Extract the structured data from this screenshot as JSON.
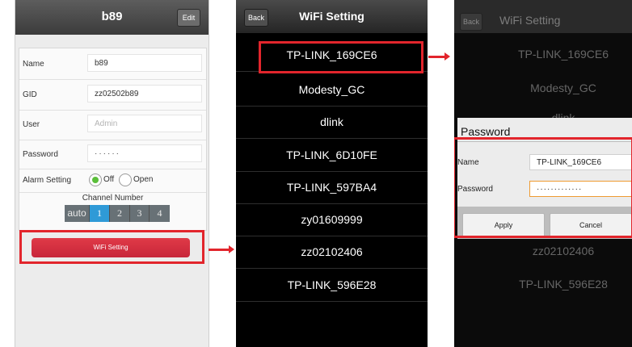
{
  "colors": {
    "highlight": "#e2252c",
    "radio_on": "#5bbf3a",
    "channel_selected": "#2f9ad7",
    "wifi_button": "#d32f3f"
  },
  "screen1": {
    "title": "b89",
    "edit_label": "Edit",
    "fields": [
      {
        "label": "Name",
        "value": "b89"
      },
      {
        "label": "GID",
        "value": "zz02502b89"
      },
      {
        "label": "User",
        "value": "Admin"
      },
      {
        "label": "Password",
        "value": "······"
      }
    ],
    "alarm": {
      "label": "Alarm Setting",
      "off": "Off",
      "open": "Open",
      "selected": "Off"
    },
    "channel": {
      "title": "Channel Number",
      "options": [
        "auto",
        "1",
        "2",
        "3",
        "4"
      ],
      "selected": "1"
    },
    "wifi_button": "WiFi Setting"
  },
  "screen2": {
    "back": "Back",
    "title": "WiFi Setting",
    "networks": [
      "TP-LINK_169CE6",
      "Modesty_GC",
      "dlink",
      "TP-LINK_6D10FE",
      "TP-LINK_597BA4",
      "zy01609999",
      "zz02102406",
      "TP-LINK_596E28"
    ]
  },
  "screen3": {
    "back": "Back",
    "title": "WiFi Setting",
    "networks_visible": [
      "TP-LINK_169CE6",
      "Modesty_GC",
      "dlink"
    ],
    "networks_below": [
      "zz02102406",
      "TP-LINK_596E28"
    ],
    "dialog": {
      "title": "Password",
      "name_label": "Name",
      "name_value": "TP-LINK_169CE6",
      "password_label": "Password",
      "password_value": "·············",
      "apply": "Apply",
      "cancel": "Cancel"
    }
  }
}
